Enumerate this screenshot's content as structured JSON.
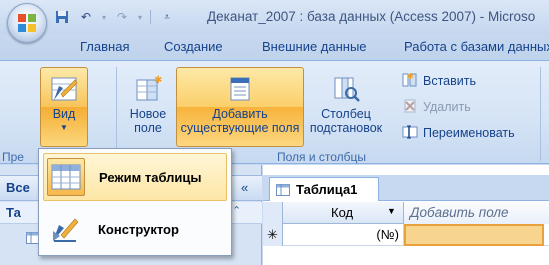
{
  "window": {
    "title": "Деканат_2007 : база данных (Access 2007) - Microso"
  },
  "qat": {
    "save_icon": "save-icon",
    "undo_icon": "undo-icon",
    "redo_icon": "redo-icon",
    "customize_icon": "customize-qat-icon"
  },
  "ribbon_tabs": [
    {
      "label": "Главная"
    },
    {
      "label": "Создание"
    },
    {
      "label": "Внешние данные"
    },
    {
      "label": "Работа с базами данных"
    }
  ],
  "ribbon": {
    "view_button": {
      "label": "Вид"
    },
    "new_field_button": {
      "label": "Новое\nполе"
    },
    "add_existing_button": {
      "label": "Добавить\nсуществующие поля"
    },
    "lookup_column_button": {
      "label": "Столбец\nподстановок"
    },
    "insert_button": {
      "label": "Вставить"
    },
    "delete_button": {
      "label": "Удалить"
    },
    "rename_button": {
      "label": "Переименовать"
    },
    "group_views_label": "Пре",
    "group_fields_label": "Поля и столбцы"
  },
  "view_menu": {
    "items": [
      {
        "label": "Режим таблицы",
        "icon": "datasheet-view-icon",
        "highlighted": true
      },
      {
        "label": "Конструктор",
        "icon": "design-view-icon",
        "highlighted": false
      }
    ]
  },
  "nav_pane": {
    "title": "Все",
    "collapse": "«",
    "section": "Та",
    "section_chevron": "⌃"
  },
  "document": {
    "tab_label": "Таблица1",
    "columns": [
      {
        "label": "Код"
      },
      {
        "label": "Добавить поле"
      }
    ],
    "new_row": {
      "selector": "✳",
      "kod": "(№)"
    }
  },
  "colors": {
    "highlight": "#f7b33b",
    "ribbon_text": "#15428b"
  }
}
